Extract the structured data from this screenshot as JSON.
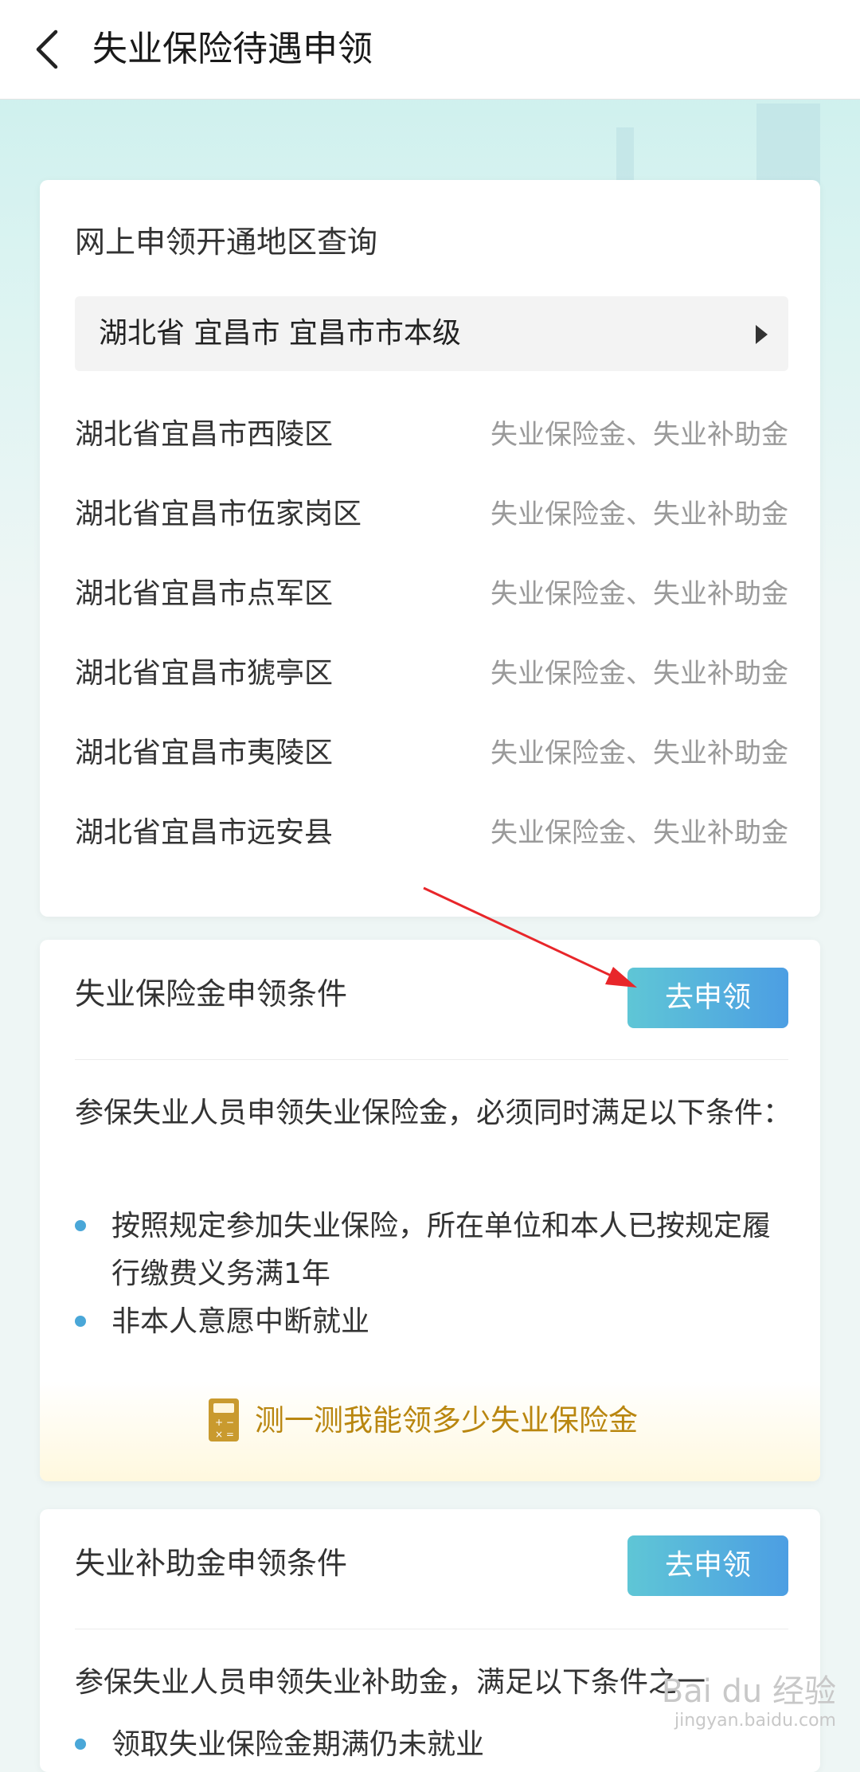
{
  "nav": {
    "title": "失业保险待遇申领",
    "back_icon": "chevron-left-icon"
  },
  "region_query": {
    "title": "网上申领开通地区查询",
    "selected_region": "湖北省 宜昌市 宜昌市市本级",
    "selector_icon": "triangle-right-icon",
    "regions": [
      {
        "name": "湖北省宜昌市西陵区",
        "services": "失业保险金、失业补助金"
      },
      {
        "name": "湖北省宜昌市伍家岗区",
        "services": "失业保险金、失业补助金"
      },
      {
        "name": "湖北省宜昌市点军区",
        "services": "失业保险金、失业补助金"
      },
      {
        "name": "湖北省宜昌市猇亭区",
        "services": "失业保险金、失业补助金"
      },
      {
        "name": "湖北省宜昌市夷陵区",
        "services": "失业保险金、失业补助金"
      },
      {
        "name": "湖北省宜昌市远安县",
        "services": "失业保险金、失业补助金"
      }
    ]
  },
  "insurance_conditions": {
    "title": "失业保险金申领条件",
    "apply_label": "去申领",
    "intro": "参保失业人员申领失业保险金，必须同时满足以下条件：",
    "bullets": [
      "按照规定参加失业保险，所在单位和本人已按规定履行缴费义务满1年",
      "非本人意愿中断就业"
    ],
    "calculator_label": "测一测我能领多少失业保险金",
    "calculator_icon": "calculator-icon"
  },
  "subsidy_conditions": {
    "title": "失业补助金申领条件",
    "apply_label": "去申领",
    "intro": "参保失业人员申领失业补助金，满足以下条件之一",
    "first_item": "领取失业保险金期满仍未就业"
  },
  "watermark": {
    "text": "Bai du 经验",
    "url": "jingyan.baidu.com"
  },
  "colors": {
    "button_start": "#5fc6d6",
    "button_end": "#4c9ee3",
    "bullet": "#4aa7d8",
    "calculator_text": "#b9860f",
    "annotation_arrow": "#e8262a"
  }
}
